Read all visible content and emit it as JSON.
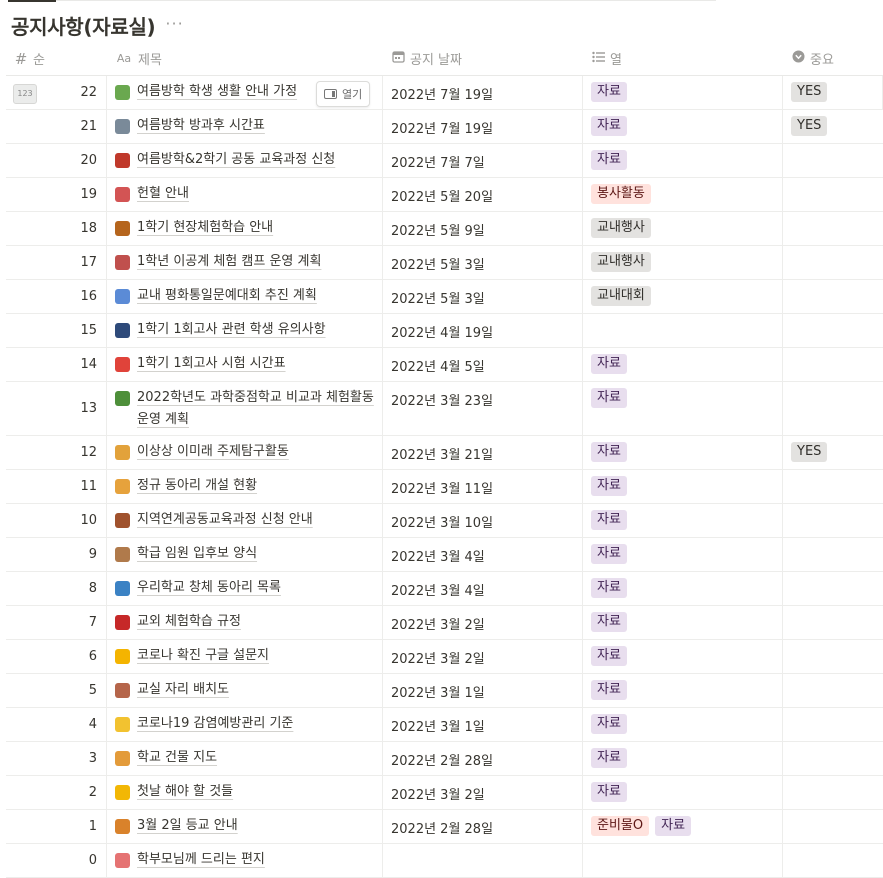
{
  "page": {
    "title": "공지사항(자료실)",
    "more_icon": "···"
  },
  "headers": {
    "num": {
      "icon": "#",
      "label": "순"
    },
    "title": {
      "icon": "Aa",
      "label": "제목"
    },
    "date": {
      "icon": "calendar-icon",
      "label": "공지 날짜"
    },
    "col": {
      "icon": "list-icon",
      "label": "열"
    },
    "imp": {
      "icon": "circle-chevron-icon",
      "label": "중요"
    }
  },
  "row_hover": {
    "number_badge": "123",
    "open_label": "열기"
  },
  "tag_colors": {
    "자료": {
      "bg": "#e8deee",
      "fg": "#412454"
    },
    "봉사활동": {
      "bg": "#ffe2dd",
      "fg": "#5d1715"
    },
    "교내행사": {
      "bg": "#e3e2e0",
      "fg": "#32302c"
    },
    "교내대회": {
      "bg": "#e3e2e0",
      "fg": "#32302c"
    },
    "준비물O": {
      "bg": "#ffe2dd",
      "fg": "#5d1715"
    },
    "YES": {
      "bg": "#e3e2e0",
      "fg": "#32302c"
    }
  },
  "rows": [
    {
      "num": "22",
      "icon": "leaf-icon",
      "color": "#6aa84f",
      "title": "여름방학 학생 생활 안내 가정",
      "date": "2022년 7월 19일",
      "tags": [
        "자료"
      ],
      "important": "YES"
    },
    {
      "num": "21",
      "icon": "tool-icon",
      "color": "#7a8a99",
      "title": "여름방학 방과후 시간표",
      "date": "2022년 7월 19일",
      "tags": [
        "자료"
      ],
      "important": "YES"
    },
    {
      "num": "20",
      "icon": "train-icon",
      "color": "#c0392b",
      "title": "여름방학&2학기 공동 교육과정 신청",
      "date": "2022년 7월 7일",
      "tags": [
        "자료"
      ],
      "important": ""
    },
    {
      "num": "19",
      "icon": "ambulance-icon",
      "color": "#d35454",
      "title": "헌혈 안내",
      "date": "2022년 5월 20일",
      "tags": [
        "봉사활동"
      ],
      "important": ""
    },
    {
      "num": "18",
      "icon": "bowl-icon",
      "color": "#b5651d",
      "title": "1학기 현장체험학습 안내",
      "date": "2022년 5월 9일",
      "tags": [
        "교내행사"
      ],
      "important": ""
    },
    {
      "num": "17",
      "icon": "brick-icon",
      "color": "#c0504d",
      "title": "1학년 이공계 체험 캠프 운영 계획",
      "date": "2022년 5월 3일",
      "tags": [
        "교내행사"
      ],
      "important": ""
    },
    {
      "num": "16",
      "icon": "shoe-icon",
      "color": "#5b8bd6",
      "title": "교내 평화통일문예대회 추진 계획",
      "date": "2022년 5월 3일",
      "tags": [
        "교내대회"
      ],
      "important": ""
    },
    {
      "num": "15",
      "icon": "fireworks-icon",
      "color": "#2e4a7a",
      "title": "1학기 1회고사 관련 학생 유의사항",
      "date": "2022년 4월 19일",
      "tags": [],
      "important": ""
    },
    {
      "num": "14",
      "icon": "hundred-icon",
      "color": "#e0433a",
      "title": "1학기 1회고사 시험 시간표",
      "date": "2022년 4월 5일",
      "tags": [
        "자료"
      ],
      "important": ""
    },
    {
      "num": "13",
      "icon": "tree-icon",
      "color": "#4e8f3a",
      "title": "2022학년도 과학중점학교 비교과 체험활동 운영 계획",
      "date": "2022년 3월 23일",
      "tags": [
        "자료"
      ],
      "important": ""
    },
    {
      "num": "12",
      "icon": "medal-icon",
      "color": "#e2a23b",
      "title": "이상상 이미래 주제탐구활동",
      "date": "2022년 3월 21일",
      "tags": [
        "자료"
      ],
      "important": "YES"
    },
    {
      "num": "11",
      "icon": "ruler-icon",
      "color": "#e6a23c",
      "title": "정규 동아리 개설 현황",
      "date": "2022년 3월 11일",
      "tags": [
        "자료"
      ],
      "important": ""
    },
    {
      "num": "10",
      "icon": "door-icon",
      "color": "#a0522d",
      "title": "지역연계공동교육과정 신청 안내",
      "date": "2022년 3월 10일",
      "tags": [
        "자료"
      ],
      "important": ""
    },
    {
      "num": "9",
      "icon": "people-icon",
      "color": "#b07a4b",
      "title": "학급 임원 입후보 양식",
      "date": "2022년 3월 4일",
      "tags": [
        "자료"
      ],
      "important": ""
    },
    {
      "num": "8",
      "icon": "flag-icon",
      "color": "#3b82c4",
      "title": "우리학교 창체 동아리 목록",
      "date": "2022년 3월 4일",
      "tags": [
        "자료"
      ],
      "important": ""
    },
    {
      "num": "7",
      "icon": "glove-icon",
      "color": "#c62828",
      "title": "교외 체험학습 규정",
      "date": "2022년 3월 2일",
      "tags": [
        "자료"
      ],
      "important": ""
    },
    {
      "num": "6",
      "icon": "star-icon",
      "color": "#f4b400",
      "title": "코로나 확진 구글 설문지",
      "date": "2022년 3월 2일",
      "tags": [
        "자료"
      ],
      "important": ""
    },
    {
      "num": "5",
      "icon": "chair-icon",
      "color": "#b5654a",
      "title": "교실 자리 배치도",
      "date": "2022년 3월 1일",
      "tags": [
        "자료"
      ],
      "important": ""
    },
    {
      "num": "4",
      "icon": "mask-face-icon",
      "color": "#f2c230",
      "title": "코로나19 감염예방관리 기준",
      "date": "2022년 3월 1일",
      "tags": [
        "자료"
      ],
      "important": ""
    },
    {
      "num": "3",
      "icon": "compass-icon",
      "color": "#e39b3a",
      "title": "학교 건물 지도",
      "date": "2022년 2월 28일",
      "tags": [
        "자료"
      ],
      "important": ""
    },
    {
      "num": "2",
      "icon": "lightning-icon",
      "color": "#f2b705",
      "title": "첫날 해야 할 것들",
      "date": "2022년 3월 2일",
      "tags": [
        "자료"
      ],
      "important": ""
    },
    {
      "num": "1",
      "icon": "sunrise-icon",
      "color": "#d9822b",
      "title": "3월 2일 등교 안내",
      "date": "2022년 2월 28일",
      "tags": [
        "준비물O",
        "자료"
      ],
      "important": ""
    },
    {
      "num": "0",
      "icon": "love-letter-icon",
      "color": "#e57373",
      "title": "학부모님께 드리는 편지",
      "date": "",
      "tags": [],
      "important": ""
    }
  ]
}
